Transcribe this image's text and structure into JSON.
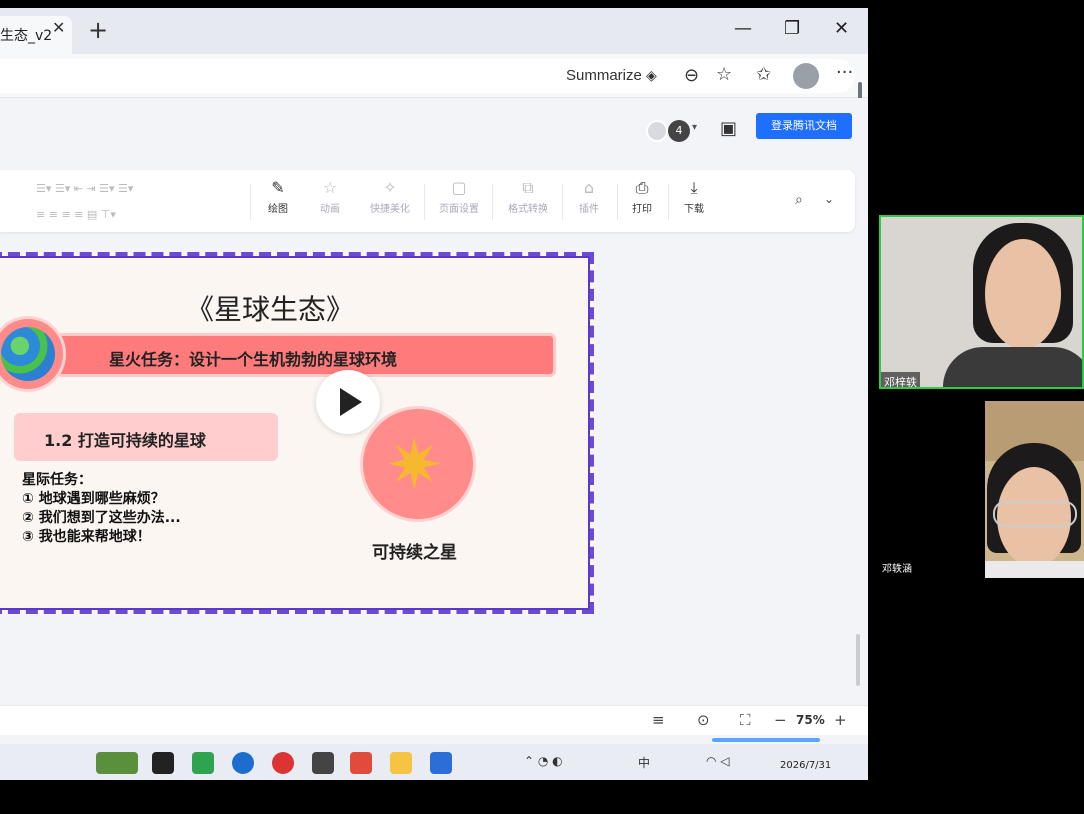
{
  "browser": {
    "tab_title": "生态_v2",
    "summarize_label": "Summarize",
    "collaborators_count": "4",
    "login_button": "登录腾讯文档"
  },
  "toolbar": {
    "items": [
      {
        "label": "绘图",
        "icon": "draw-icon",
        "enabled": true
      },
      {
        "label": "动画",
        "icon": "animation-icon",
        "enabled": false
      },
      {
        "label": "快捷美化",
        "icon": "beautify-icon",
        "enabled": false
      },
      {
        "label": "页面设置",
        "icon": "page-setup-icon",
        "enabled": false
      },
      {
        "label": "格式转换",
        "icon": "format-convert-icon",
        "enabled": false
      },
      {
        "label": "插件",
        "icon": "plugin-icon",
        "enabled": false
      },
      {
        "label": "打印",
        "icon": "print-icon",
        "enabled": true
      },
      {
        "label": "下载",
        "icon": "download-icon",
        "enabled": true
      }
    ]
  },
  "slide": {
    "title": "《星球生态》",
    "mission": "星火任务：设计一个生机勃勃的星球环境",
    "subtitle": "1.2 打造可持续的星球",
    "tasks_heading": "星际任务：",
    "tasks": [
      "① 地球遇到哪些麻烦？",
      "② 我们想到了这些办法...",
      "③ 我也能来帮地球！"
    ],
    "star_caption": "可持续之星"
  },
  "statusbar": {
    "zoom": "75%"
  },
  "taskbar": {
    "date": "2026/7/31",
    "ime": "中"
  },
  "video": {
    "participant1": "邓梓轶",
    "participant2": "邓轶涵"
  }
}
